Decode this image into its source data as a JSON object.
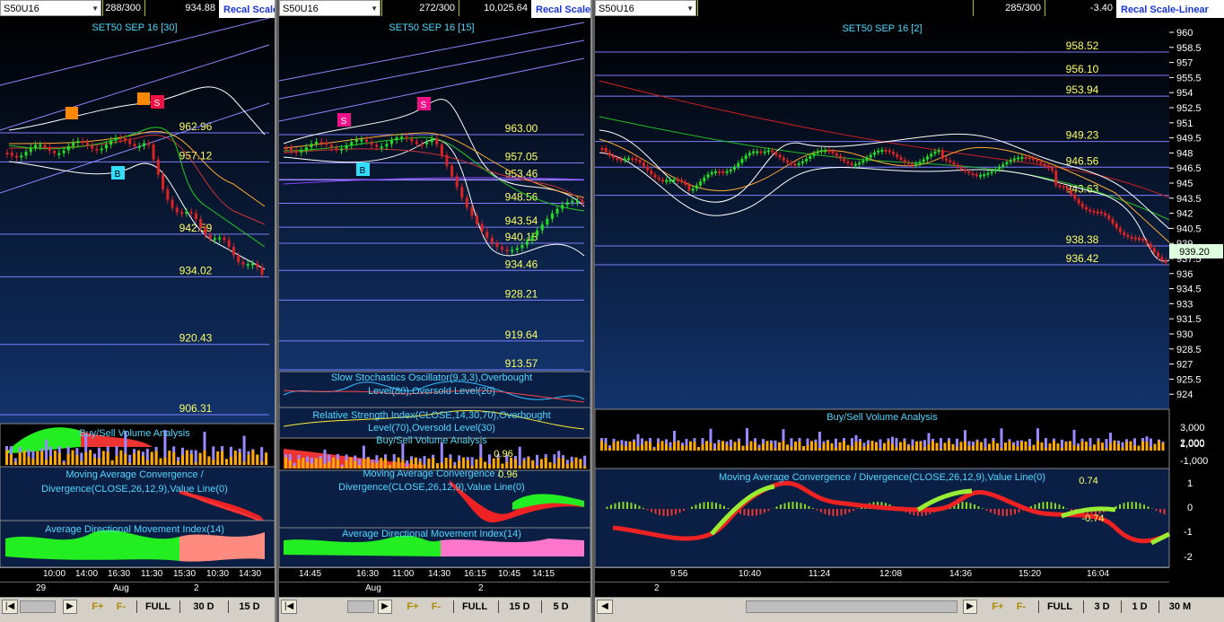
{
  "panes": [
    {
      "symbol": "S50U16",
      "bars": "288/300",
      "price": "934.88",
      "recal_label": "Recal Scale",
      "title": "SET50 SEP 16  [30]",
      "levels": [
        "962.96",
        "957.12",
        "942.59",
        "934.02",
        "920.43",
        "906.31"
      ],
      "volume_title": "Buy/Sell Volume Analysis",
      "macd_title_1": "Moving Average Convergence /",
      "macd_title_2": "Divergence(CLOSE,26,12,9),Value Line(0)",
      "adx_title": "Average Directional Movement Index(14)",
      "times": [
        "10:00",
        "14:00",
        "16:30",
        "11:30",
        "15:30",
        "10:30",
        "14:30"
      ],
      "dates": [
        "29",
        "Aug",
        "2"
      ],
      "tf_buttons": [
        "FULL",
        "30 D",
        "15 D"
      ],
      "markers": [
        "S",
        "B"
      ]
    },
    {
      "symbol": "S50U16",
      "bars": "272/300",
      "price": "10,025.64",
      "recal_label": "Recal Scale",
      "title": "SET50 SEP 16  [15]",
      "levels": [
        "963.00",
        "957.05",
        "953.46",
        "948.56",
        "943.54",
        "940.18",
        "934.46",
        "928.21",
        "919.64",
        "913.57"
      ],
      "stoch_title_1": "Slow Stochastics Oscillator(9,3,3),Overbought",
      "stoch_title_2": "Level(80),Oversold Level(20)",
      "rsi_title_1": "Relative Strength Index(CLOSE,14,30,70),Overbought",
      "rsi_title_2": "Level(70),Oversold Level(30)",
      "volume_title": "Buy/Sell Volume Analysis",
      "vol_value": "0.96",
      "macd_value": "0.96",
      "macd_title_1": "Moving Average Convergence /",
      "macd_title_2": "Divergence(CLOSE,26,12,9),Value Line(0)",
      "adx_title": "Average Directional Movement Index(14)",
      "times": [
        "14:45",
        "16:30",
        "11:00",
        "14:30",
        "16:15",
        "10:45",
        "14:15"
      ],
      "dates": [
        "Aug",
        "2"
      ],
      "tf_buttons": [
        "FULL",
        "15 D",
        "5 D"
      ],
      "markers": [
        "S",
        "S",
        "B"
      ]
    },
    {
      "symbol": "S50U16",
      "bars": "285/300",
      "price": "-3.40",
      "recal_label": "Recal Scale-Linear",
      "title": "SET50 SEP 16  [2]",
      "levels": [
        "958.52",
        "956.10",
        "953.94",
        "949.23",
        "946.56",
        "943.63",
        "938.38",
        "936.42"
      ],
      "axis": [
        "960",
        "958.5",
        "957",
        "955.5",
        "954",
        "952.5",
        "951",
        "949.5",
        "948",
        "946.5",
        "945",
        "943.5",
        "942",
        "940.5",
        "939",
        "937.5",
        "936",
        "934.5",
        "933",
        "931.5",
        "930",
        "928.5",
        "927",
        "925.5",
        "924"
      ],
      "last_price": "939.20",
      "volume_title": "Buy/Sell Volume Analysis",
      "vol_axis": [
        "3,000",
        "2,000",
        "1,000",
        "-1,000"
      ],
      "macd_title": "Moving Average Convergence / Divergence(CLOSE,26,12,9),Value Line(0)",
      "macd_value_pos": "0.74",
      "macd_value_neg": "-0.74",
      "macd_axis": [
        "1",
        "0",
        "-1",
        "-2"
      ],
      "times": [
        "9:56",
        "10:40",
        "11:24",
        "12:08",
        "14:36",
        "15:20",
        "16:04"
      ],
      "dates": [
        "2"
      ],
      "tf_buttons": [
        "FULL",
        "3 D",
        "1 D",
        "30 M"
      ]
    }
  ],
  "nav": {
    "first": "|◀",
    "prev": "◀",
    "next": "▶",
    "last": "▶|",
    "fplus": "F+",
    "fminus": "F-"
  },
  "colors": {
    "bg_top": "#000000",
    "bg_bottom": "#0e2a5a",
    "level_line": "#8080ff",
    "level_text": "#ffff66",
    "title_text": "#4fd7ff",
    "up": "#22dd22",
    "down": "#dd2222",
    "buy_volume": "#ffaa00",
    "sell_volume": "#9988ff"
  }
}
